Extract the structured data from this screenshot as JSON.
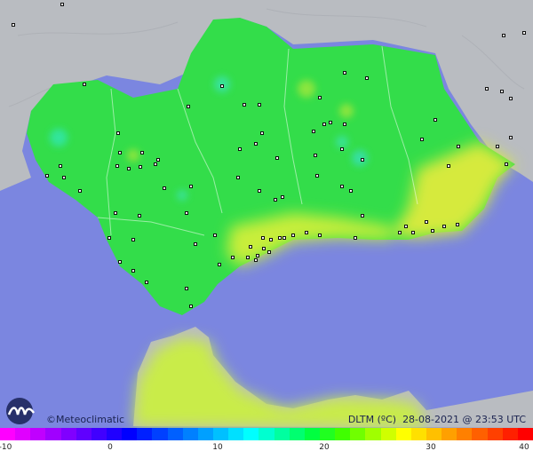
{
  "credit": "©Meteoclimatic",
  "caption": {
    "variable": "DLTM (ºC)",
    "date": "28-08-2021",
    "time": "@ 23:53 UTC"
  },
  "scale": {
    "ticks": [
      "-10",
      "0",
      "10",
      "20",
      "30",
      "40"
    ],
    "min": -10,
    "max": 40,
    "colors": [
      "#ff00ff",
      "#e000ff",
      "#c000ff",
      "#a000ff",
      "#8000ff",
      "#6000ff",
      "#4000ff",
      "#2000ff",
      "#0000ff",
      "#0020ff",
      "#0040ff",
      "#0060ff",
      "#0080ff",
      "#00a0ff",
      "#00c0ff",
      "#00e0ff",
      "#00ffff",
      "#00ffd0",
      "#00ffa0",
      "#00ff70",
      "#00ff40",
      "#20ff20",
      "#40ff00",
      "#70ff00",
      "#a0ff00",
      "#d0ff00",
      "#ffff00",
      "#ffe000",
      "#ffc000",
      "#ffa000",
      "#ff8000",
      "#ff6000",
      "#ff4000",
      "#ff2000",
      "#ff0000"
    ]
  },
  "colors": {
    "sea": "#7b86e0",
    "land_outside": "#b9bcc1",
    "land_region": "#33dd4a",
    "warm_coast": "#d6ea3d",
    "border": "#ffffff"
  }
}
